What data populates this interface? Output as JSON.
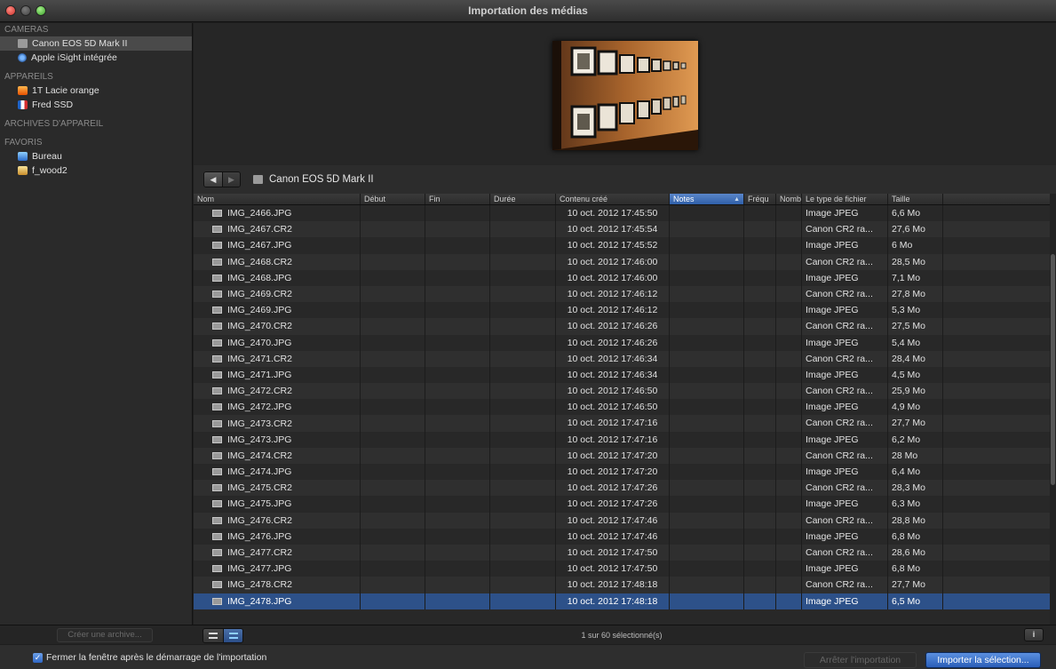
{
  "window": {
    "title": "Importation des médias"
  },
  "sidebar": {
    "sections": [
      {
        "header": "CAMERAS",
        "items": [
          {
            "label": "Canon EOS 5D Mark II",
            "icon": "camera-icon",
            "selected": true
          },
          {
            "label": "Apple iSight intégrée",
            "icon": "isight-icon",
            "selected": false
          }
        ]
      },
      {
        "header": "APPAREILS",
        "items": [
          {
            "label": "1T Lacie orange",
            "icon": "drive-orange-icon",
            "selected": false
          },
          {
            "label": "Fred SSD",
            "icon": "drive-ssd-icon",
            "selected": false
          }
        ]
      },
      {
        "header": "ARCHIVES D'APPAREIL",
        "items": []
      },
      {
        "header": "FAVORIS",
        "items": [
          {
            "label": "Bureau",
            "icon": "desktop-folder-icon",
            "selected": false
          },
          {
            "label": "f_wood2",
            "icon": "home-icon",
            "selected": false
          }
        ]
      }
    ],
    "create_archive_label": "Créer une archive..."
  },
  "pathbar": {
    "back_glyph": "◀",
    "forward_glyph": "▶",
    "device_label": "Canon EOS 5D Mark II"
  },
  "table": {
    "columns": [
      "Nom",
      "Début",
      "Fin",
      "Durée",
      "Contenu créé",
      "Notes",
      "Fréqu",
      "Nombr",
      "Le type de fichier",
      "Taille"
    ],
    "sorted_column": "Notes",
    "rows": [
      {
        "name": "IMG_2466.JPG",
        "created": "10 oct. 2012 17:45:50",
        "type": "Image JPEG",
        "size": "6,6 Mo",
        "selected": false
      },
      {
        "name": "IMG_2467.CR2",
        "created": "10 oct. 2012 17:45:54",
        "type": "Canon CR2 ra...",
        "size": "27,6 Mo",
        "selected": false
      },
      {
        "name": "IMG_2467.JPG",
        "created": "10 oct. 2012 17:45:52",
        "type": "Image JPEG",
        "size": "6 Mo",
        "selected": false
      },
      {
        "name": "IMG_2468.CR2",
        "created": "10 oct. 2012 17:46:00",
        "type": "Canon CR2 ra...",
        "size": "28,5 Mo",
        "selected": false
      },
      {
        "name": "IMG_2468.JPG",
        "created": "10 oct. 2012 17:46:00",
        "type": "Image JPEG",
        "size": "7,1 Mo",
        "selected": false
      },
      {
        "name": "IMG_2469.CR2",
        "created": "10 oct. 2012 17:46:12",
        "type": "Canon CR2 ra...",
        "size": "27,8 Mo",
        "selected": false
      },
      {
        "name": "IMG_2469.JPG",
        "created": "10 oct. 2012 17:46:12",
        "type": "Image JPEG",
        "size": "5,3 Mo",
        "selected": false
      },
      {
        "name": "IMG_2470.CR2",
        "created": "10 oct. 2012 17:46:26",
        "type": "Canon CR2 ra...",
        "size": "27,5 Mo",
        "selected": false
      },
      {
        "name": "IMG_2470.JPG",
        "created": "10 oct. 2012 17:46:26",
        "type": "Image JPEG",
        "size": "5,4 Mo",
        "selected": false
      },
      {
        "name": "IMG_2471.CR2",
        "created": "10 oct. 2012 17:46:34",
        "type": "Canon CR2 ra...",
        "size": "28,4 Mo",
        "selected": false
      },
      {
        "name": "IMG_2471.JPG",
        "created": "10 oct. 2012 17:46:34",
        "type": "Image JPEG",
        "size": "4,5 Mo",
        "selected": false
      },
      {
        "name": "IMG_2472.CR2",
        "created": "10 oct. 2012 17:46:50",
        "type": "Canon CR2 ra...",
        "size": "25,9 Mo",
        "selected": false
      },
      {
        "name": "IMG_2472.JPG",
        "created": "10 oct. 2012 17:46:50",
        "type": "Image JPEG",
        "size": "4,9 Mo",
        "selected": false
      },
      {
        "name": "IMG_2473.CR2",
        "created": "10 oct. 2012 17:47:16",
        "type": "Canon CR2 ra...",
        "size": "27,7 Mo",
        "selected": false
      },
      {
        "name": "IMG_2473.JPG",
        "created": "10 oct. 2012 17:47:16",
        "type": "Image JPEG",
        "size": "6,2 Mo",
        "selected": false
      },
      {
        "name": "IMG_2474.CR2",
        "created": "10 oct. 2012 17:47:20",
        "type": "Canon CR2 ra...",
        "size": "28 Mo",
        "selected": false
      },
      {
        "name": "IMG_2474.JPG",
        "created": "10 oct. 2012 17:47:20",
        "type": "Image JPEG",
        "size": "6,4 Mo",
        "selected": false
      },
      {
        "name": "IMG_2475.CR2",
        "created": "10 oct. 2012 17:47:26",
        "type": "Canon CR2 ra...",
        "size": "28,3 Mo",
        "selected": false
      },
      {
        "name": "IMG_2475.JPG",
        "created": "10 oct. 2012 17:47:26",
        "type": "Image JPEG",
        "size": "6,3 Mo",
        "selected": false
      },
      {
        "name": "IMG_2476.CR2",
        "created": "10 oct. 2012 17:47:46",
        "type": "Canon CR2 ra...",
        "size": "28,8 Mo",
        "selected": false
      },
      {
        "name": "IMG_2476.JPG",
        "created": "10 oct. 2012 17:47:46",
        "type": "Image JPEG",
        "size": "6,8 Mo",
        "selected": false
      },
      {
        "name": "IMG_2477.CR2",
        "created": "10 oct. 2012 17:47:50",
        "type": "Canon CR2 ra...",
        "size": "28,6 Mo",
        "selected": false
      },
      {
        "name": "IMG_2477.JPG",
        "created": "10 oct. 2012 17:47:50",
        "type": "Image JPEG",
        "size": "6,8 Mo",
        "selected": false
      },
      {
        "name": "IMG_2478.CR2",
        "created": "10 oct. 2012 17:48:18",
        "type": "Canon CR2 ra...",
        "size": "27,7 Mo",
        "selected": false
      },
      {
        "name": "IMG_2478.JPG",
        "created": "10 oct. 2012 17:48:18",
        "type": "Image JPEG",
        "size": "6,5 Mo",
        "selected": true
      }
    ]
  },
  "statusbar": {
    "selection_text": "1 sur 60 sélectionné(s)",
    "info_glyph": "i"
  },
  "footer": {
    "close_after_import_label": "Fermer la fenêtre après le démarrage de l'importation",
    "close_after_import_checked": true,
    "stop_import_label": "Arrêter l'importation",
    "import_selection_label": "Importer la sélection..."
  },
  "colors": {
    "accent": "#2d5189",
    "sorted_header": "#3f70bd",
    "background": "#282828"
  }
}
